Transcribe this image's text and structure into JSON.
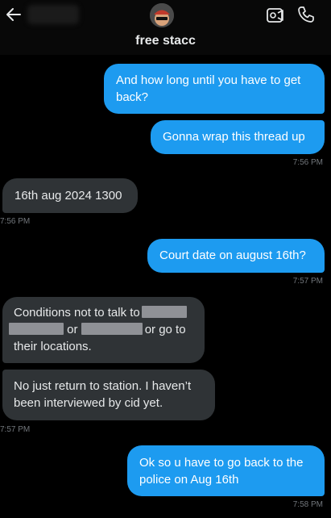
{
  "header": {
    "title": "free stacc",
    "icons": [
      "back-arrow-icon",
      "video-call-icon",
      "phone-icon"
    ]
  },
  "messages": [
    {
      "id": "m1",
      "side": "outgoing",
      "text": "And how long until you have to get back?"
    },
    {
      "id": "m2",
      "side": "outgoing",
      "text": "Gonna wrap this thread up",
      "time": "7:56 PM"
    },
    {
      "id": "m3",
      "side": "incoming",
      "text": "16th aug 2024 1300",
      "time": "7:56 PM"
    },
    {
      "id": "m4",
      "side": "outgoing",
      "text": "Court date on august 16th?",
      "time": "7:57 PM"
    },
    {
      "id": "m5",
      "side": "incoming",
      "line1": "Conditions not to talk to",
      "line2a": "or",
      "line2b": "or go to",
      "line3": "their locations."
    },
    {
      "id": "m6",
      "side": "incoming",
      "text": "No just return to station. I haven’t been interviewed by cid yet.",
      "time": "7:57 PM"
    },
    {
      "id": "m7",
      "side": "outgoing",
      "text": "Ok so u have to go back to the police on Aug 16th",
      "time": "7:58 PM"
    }
  ],
  "colors": {
    "outgoing_bubble": "#1d9bf0",
    "incoming_bubble": "#2f3336",
    "background": "#000000",
    "timestamp": "#71767b"
  }
}
